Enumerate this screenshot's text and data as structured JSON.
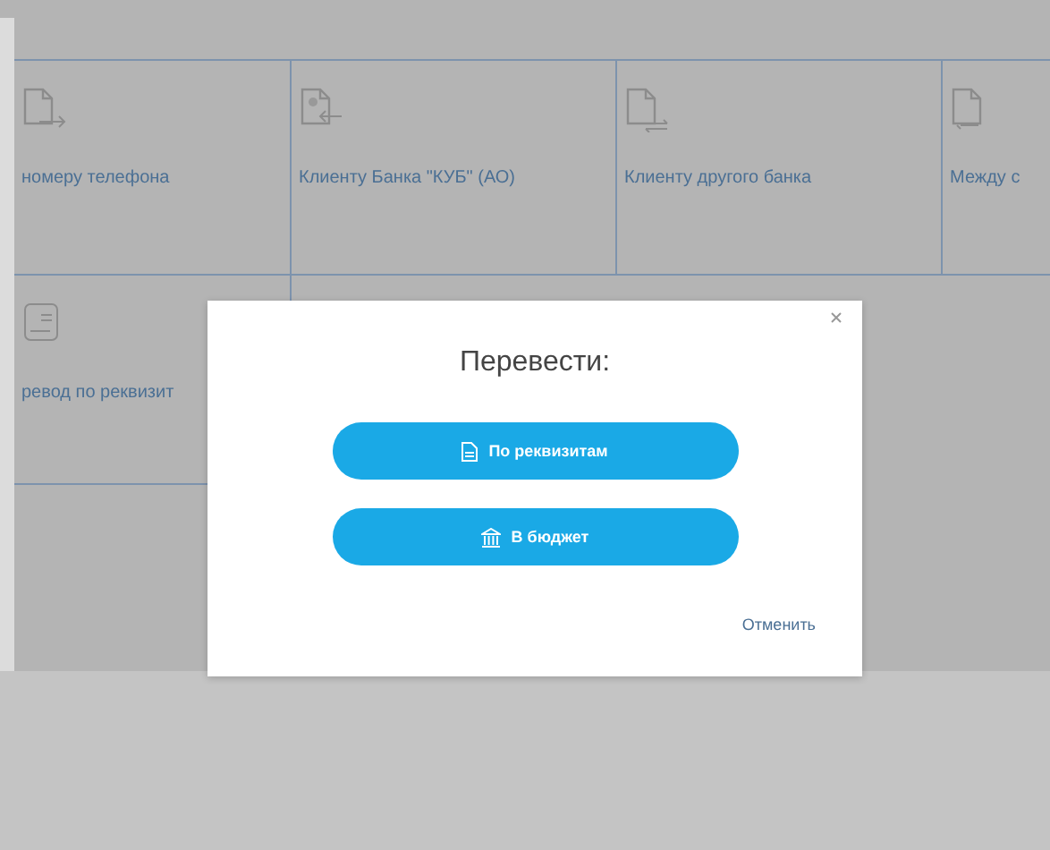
{
  "tiles": [
    {
      "label": "номеру телефона",
      "kind": "doc-out"
    },
    {
      "label": "Клиенту Банка \"КУБ\" (АО)",
      "kind": "doc-in"
    },
    {
      "label": "Клиенту другого банка",
      "kind": "doc-swap"
    },
    {
      "label": "Между с",
      "kind": "docs"
    },
    {
      "label": "ревод по реквизит",
      "kind": "doc-list"
    }
  ],
  "dialog": {
    "title": "Перевести:",
    "options": [
      {
        "label": "По реквизитам",
        "kind": "document"
      },
      {
        "label": "В бюджет",
        "kind": "bank"
      }
    ],
    "cancel": "Отменить"
  }
}
